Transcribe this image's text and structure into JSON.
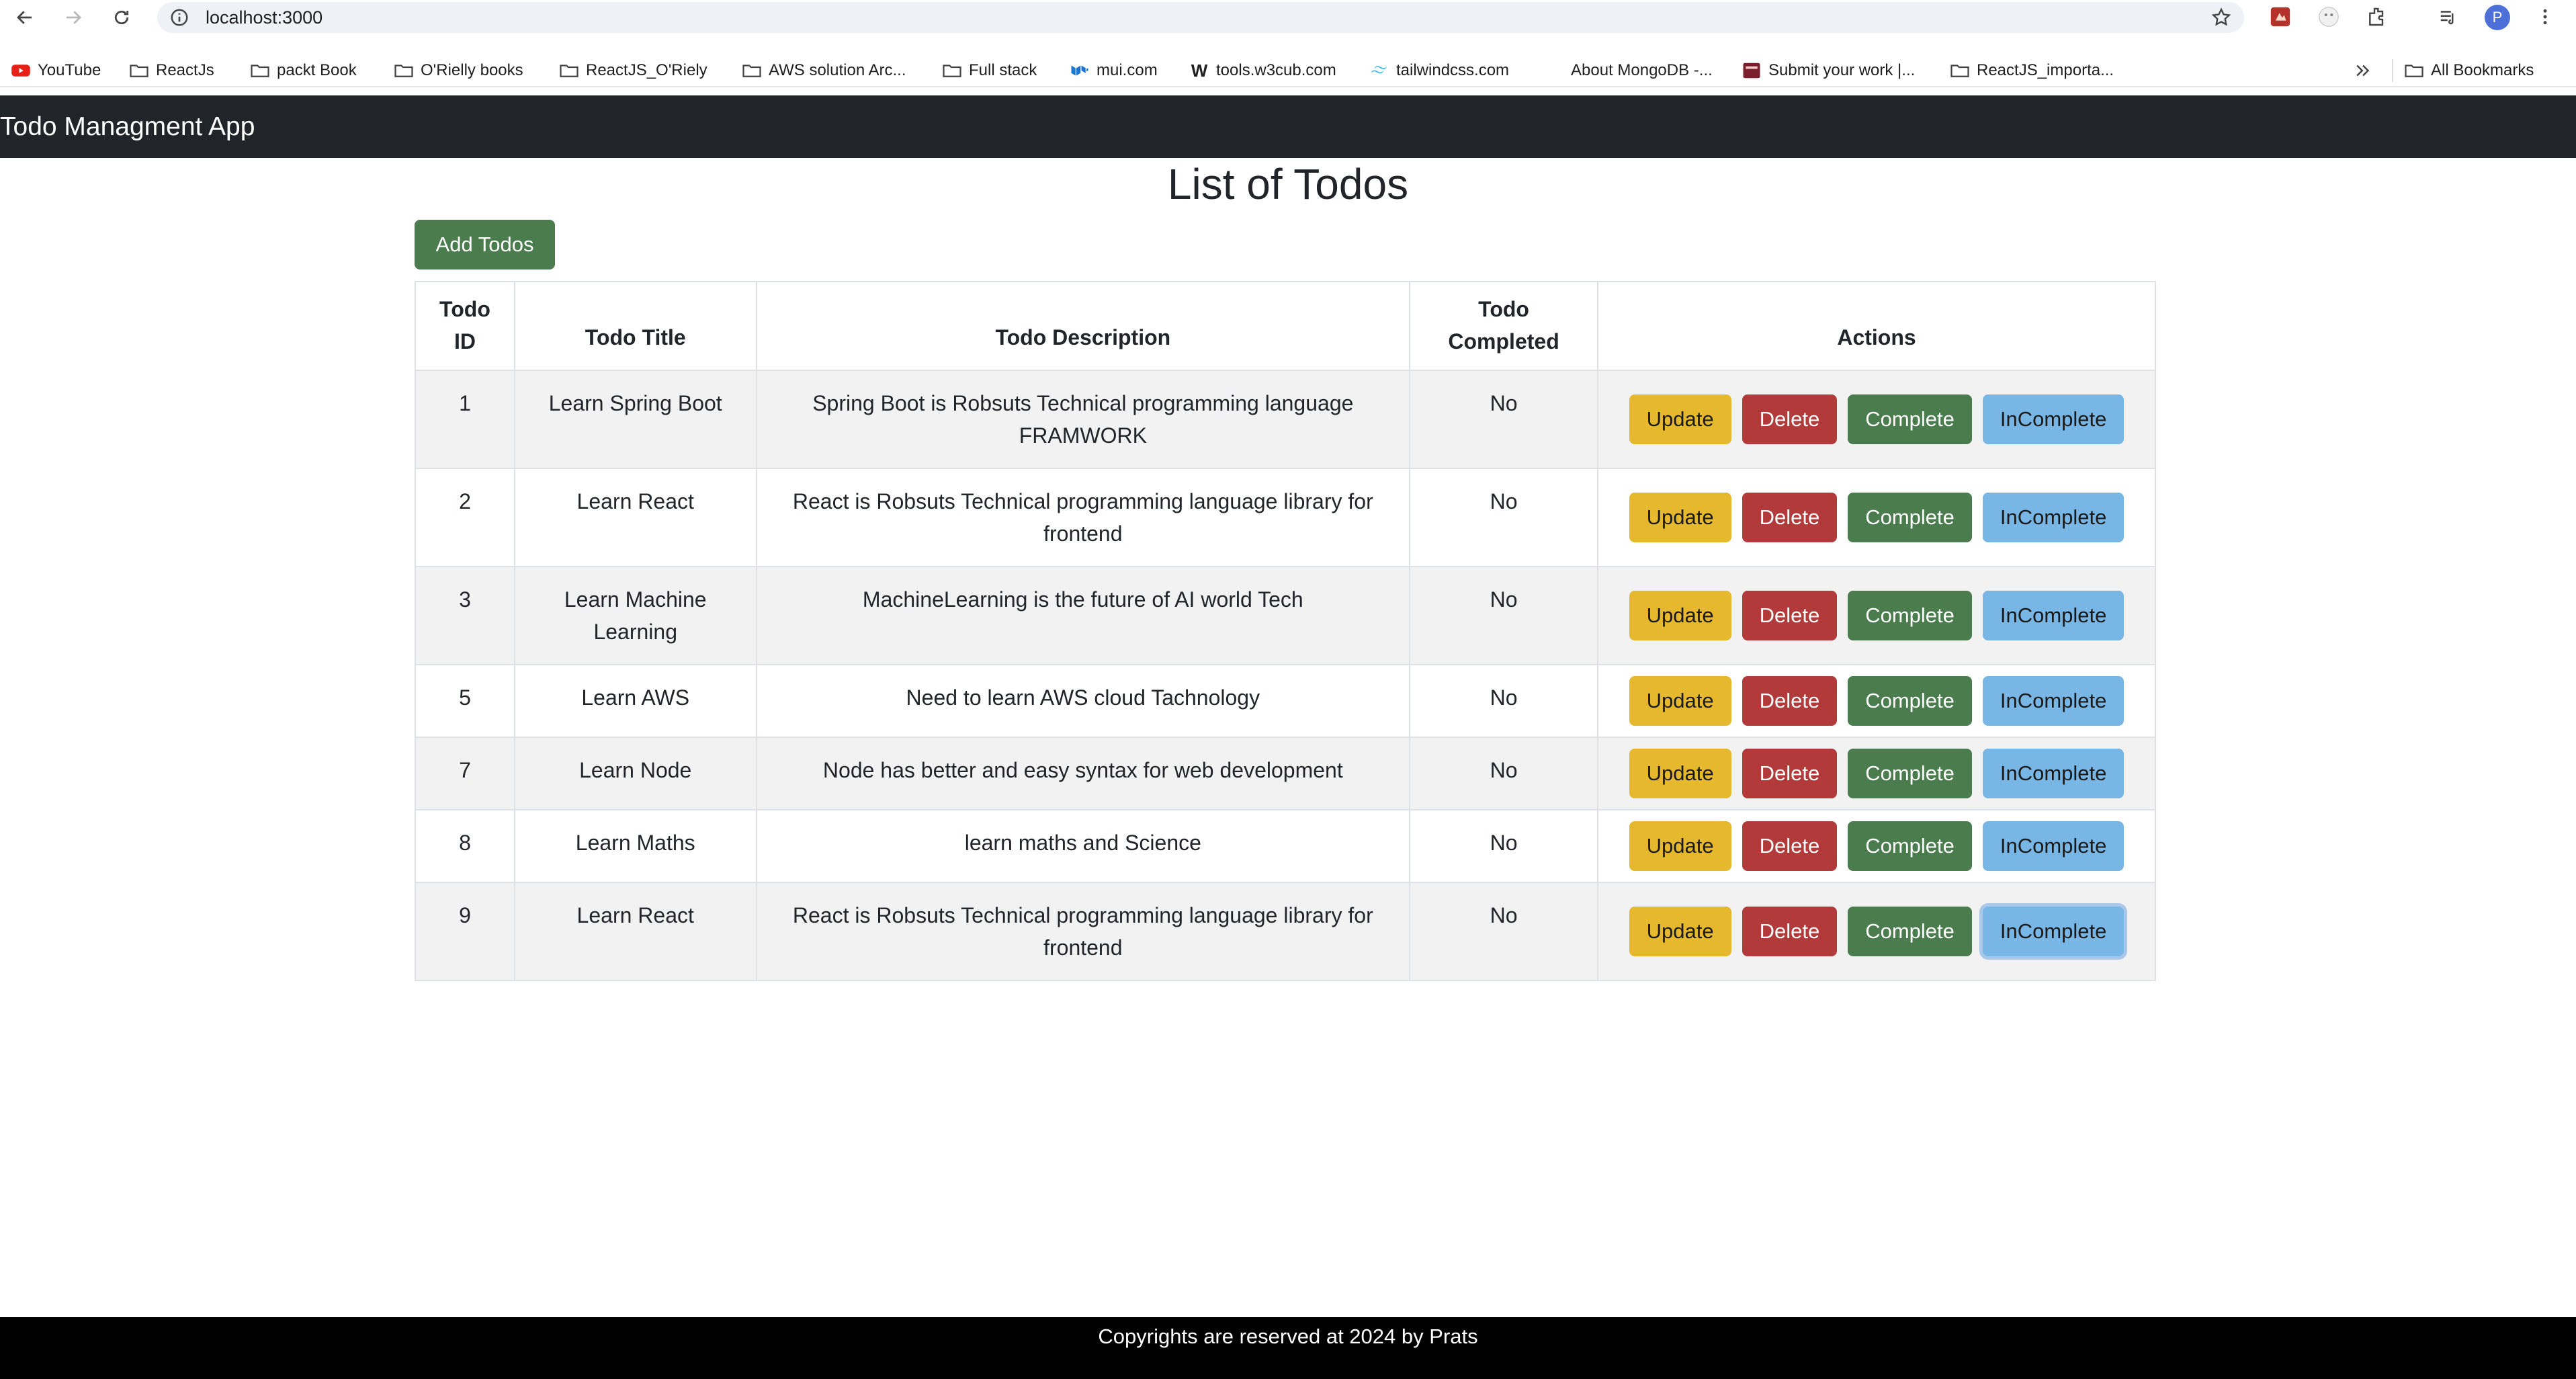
{
  "browser": {
    "url": "localhost:3000",
    "bookmarks": [
      {
        "label": "YouTube",
        "icon": "youtube-icon"
      },
      {
        "label": "ReactJs",
        "icon": "folder-icon"
      },
      {
        "label": "packt Book",
        "icon": "folder-icon"
      },
      {
        "label": "O'Rielly books",
        "icon": "folder-icon"
      },
      {
        "label": "ReactJS_O'Riely",
        "icon": "folder-icon"
      },
      {
        "label": "AWS solution Arc...",
        "icon": "folder-icon"
      },
      {
        "label": "Full stack",
        "icon": "folder-icon"
      },
      {
        "label": "mui.com",
        "icon": "mui-icon"
      },
      {
        "label": "tools.w3cub.com",
        "icon": "w3cub-icon"
      },
      {
        "label": "tailwindcss.com",
        "icon": "tailwind-icon"
      },
      {
        "label": "About MongoDB -...",
        "icon": "none"
      },
      {
        "label": "Submit your work |...",
        "icon": "site-icon"
      },
      {
        "label": "ReactJS_importa...",
        "icon": "folder-icon"
      }
    ],
    "all_bookmarks_label": "All Bookmarks",
    "avatar_letter": "P"
  },
  "app": {
    "title": "Todo Managment App",
    "page_title": "List of Todos",
    "add_button_label": "Add Todos",
    "footer": "Copyrights are reserved at 2024 by Prats"
  },
  "table": {
    "headers": {
      "id": "Todo ID",
      "title": "Todo Title",
      "description": "Todo Description",
      "completed": "Todo Completed",
      "actions": "Actions"
    },
    "action_labels": {
      "update": "Update",
      "delete": "Delete",
      "complete": "Complete",
      "incomplete": "InComplete"
    },
    "rows": [
      {
        "id": "1",
        "title": "Learn Spring Boot",
        "description": "Spring Boot is Robsuts Technical programming language FRAMWORK",
        "completed": "No"
      },
      {
        "id": "2",
        "title": "Learn React",
        "description": "React is Robsuts Technical programming language library for frontend",
        "completed": "No"
      },
      {
        "id": "3",
        "title": "Learn Machine Learning",
        "description": "MachineLearning is the future of AI world Tech",
        "completed": "No"
      },
      {
        "id": "5",
        "title": "Learn AWS",
        "description": "Need to learn AWS cloud Tachnology",
        "completed": "No"
      },
      {
        "id": "7",
        "title": "Learn Node",
        "description": "Node has better and easy syntax for web development",
        "completed": "No"
      },
      {
        "id": "8",
        "title": "Learn Maths",
        "description": "learn maths and Science",
        "completed": "No"
      },
      {
        "id": "9",
        "title": "Learn React",
        "description": "React is Robsuts Technical programming language library for frontend",
        "completed": "No"
      }
    ]
  },
  "colors": {
    "header_bg": "#212529",
    "footer_bg": "#000000",
    "success": "#4a7c4e",
    "warning": "#e6b82e",
    "danger": "#b33a3a",
    "info": "#78b6e6"
  }
}
